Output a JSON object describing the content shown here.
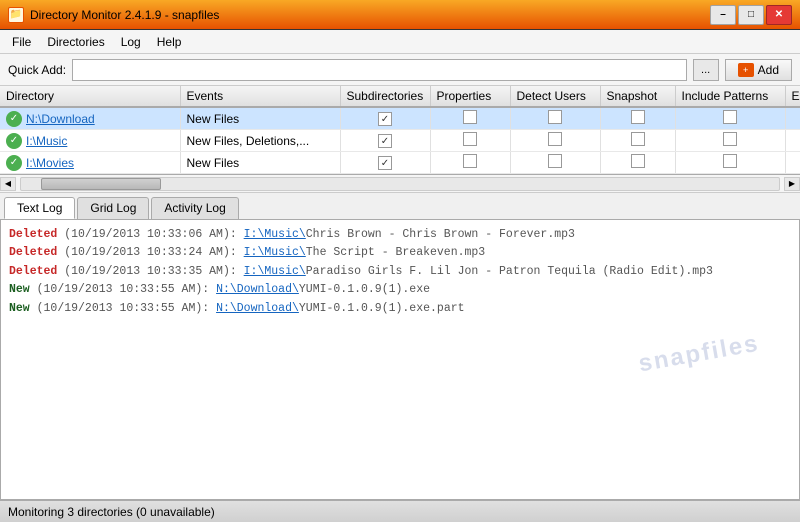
{
  "titlebar": {
    "title": "Directory Monitor 2.4.1.9 - snapfiles",
    "icon": "📁",
    "min_label": "–",
    "max_label": "□",
    "close_label": "✕"
  },
  "menubar": {
    "items": [
      "File",
      "Directories",
      "Log",
      "Help"
    ]
  },
  "quickadd": {
    "label": "Quick Add:",
    "placeholder": "",
    "browse_label": "...",
    "add_label": "Add"
  },
  "table": {
    "headers": [
      "Directory",
      "Events",
      "Subdirectories",
      "Properties",
      "Detect Users",
      "Snapshot",
      "Include Patterns",
      "Exclude Patterns"
    ],
    "rows": [
      {
        "directory": "N:\\Download",
        "events": "New Files",
        "subdirectories": true,
        "properties": false,
        "detect_users": false,
        "snapshot": false,
        "include": false,
        "exclude": false,
        "status": "ok",
        "selected": true
      },
      {
        "directory": "I:\\Music",
        "events": "New Files, Deletions,...",
        "subdirectories": true,
        "properties": false,
        "detect_users": false,
        "snapshot": false,
        "include": false,
        "exclude": false,
        "status": "ok",
        "selected": false
      },
      {
        "directory": "I:\\Movies",
        "events": "New Files",
        "subdirectories": true,
        "properties": false,
        "detect_users": false,
        "snapshot": false,
        "include": false,
        "exclude": false,
        "status": "ok",
        "selected": false
      }
    ]
  },
  "logtabs": {
    "tabs": [
      "Text Log",
      "Grid Log",
      "Activity Log"
    ],
    "active": 0
  },
  "logentries": [
    {
      "type": "Deleted",
      "timestamp": "(10/19/2013 10:33:06 AM):",
      "path_prefix": "I:\\Music\\",
      "path_link": "I:\\Music\\",
      "filename": "Chris Brown - Chris Brown - Forever.mp3"
    },
    {
      "type": "Deleted",
      "timestamp": "(10/19/2013 10:33:24 AM):",
      "path_prefix": "I:\\Music\\",
      "path_link": "I:\\Music\\",
      "filename": "The Script - Breakeven.mp3"
    },
    {
      "type": "Deleted",
      "timestamp": "(10/19/2013 10:33:35 AM):",
      "path_prefix": "I:\\Music\\",
      "path_link": "I:\\Music\\",
      "filename": "Paradiso Girls F. Lil Jon - Patron Tequila (Radio Edit).mp3"
    },
    {
      "type": "New",
      "timestamp": "(10/19/2013 10:33:55 AM):",
      "path_prefix": "N:\\Download\\",
      "path_link": "N:\\Download\\",
      "filename": "YUMI-0.1.0.9(1).exe"
    },
    {
      "type": "New",
      "timestamp": "(10/19/2013 10:33:55 AM):",
      "path_prefix": "N:\\Download\\",
      "path_link": "N:\\Download\\",
      "filename": "YUMI-0.1.0.9(1).exe.part"
    }
  ],
  "statusbar": {
    "text": "Monitoring 3 directories (0 unavailable)"
  },
  "watermark": {
    "text": "snapfiles"
  }
}
